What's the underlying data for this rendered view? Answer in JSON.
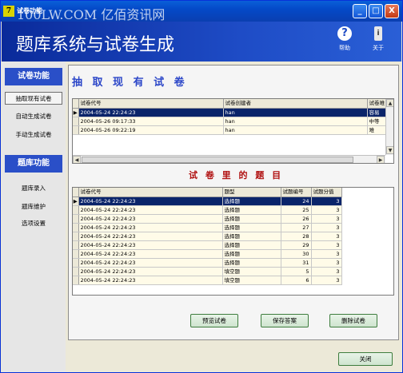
{
  "window": {
    "title": "试卷功能",
    "watermark": "100LW.COM 亿佰资讯网",
    "controls": [
      "_",
      "□",
      "X"
    ]
  },
  "header": {
    "title": "题库系统与试卷生成",
    "help_label": "帮助",
    "about_label": "关于",
    "help_icon": "?",
    "about_icon": "i"
  },
  "nav": {
    "section1": "试卷功能",
    "section1_items": [
      "抽取现有试卷",
      "自动生成试卷",
      "手动生成试卷"
    ],
    "section2": "题库功能",
    "section2_items": [
      "题库录入",
      "题库维护",
      "选项设置"
    ]
  },
  "panel": {
    "title1": "抽 取 现 有 试 卷",
    "title2": "试 卷 里 的 题 目"
  },
  "grid1": {
    "columns": [
      "试卷代号",
      "试卷创建者",
      "试卷难"
    ],
    "rows": [
      [
        "2004-05-24 22:24:23",
        "han",
        "容易"
      ],
      [
        "2004-05-26 09:17:33",
        "han",
        "中等"
      ],
      [
        "2004-05-26 09:22:19",
        "han",
        "难"
      ]
    ]
  },
  "grid2": {
    "columns": [
      "试卷代号",
      "题型",
      "试题编号",
      "试题分值"
    ],
    "rows": [
      [
        "2004-05-24 22:24:23",
        "选择题",
        "24",
        "3"
      ],
      [
        "2004-05-24 22:24:23",
        "选择题",
        "25",
        "3"
      ],
      [
        "2004-05-24 22:24:23",
        "选择题",
        "26",
        "3"
      ],
      [
        "2004-05-24 22:24:23",
        "选择题",
        "27",
        "3"
      ],
      [
        "2004-05-24 22:24:23",
        "选择题",
        "28",
        "3"
      ],
      [
        "2004-05-24 22:24:23",
        "选择题",
        "29",
        "3"
      ],
      [
        "2004-05-24 22:24:23",
        "选择题",
        "30",
        "3"
      ],
      [
        "2004-05-24 22:24:23",
        "选择题",
        "31",
        "3"
      ],
      [
        "2004-05-24 22:24:23",
        "填空题",
        "5",
        "3"
      ],
      [
        "2004-05-24 22:24:23",
        "填空题",
        "6",
        "3"
      ]
    ]
  },
  "buttons": {
    "preview": "预览试卷",
    "save_answers": "保存答案",
    "delete": "删除试卷",
    "close": "关闭"
  },
  "colors": {
    "header_bg": "#0b2fa8",
    "selection": "#0a246a",
    "section_title": "#2b46c8",
    "sub_title": "#b01010"
  }
}
